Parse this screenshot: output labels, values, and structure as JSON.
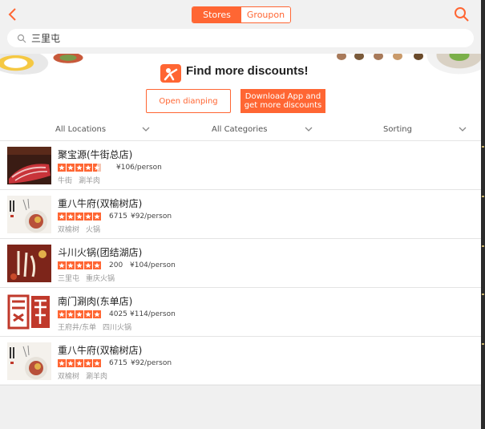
{
  "header": {
    "tabs": [
      {
        "label": "Stores",
        "active": true
      },
      {
        "label": "Groupon",
        "active": false
      }
    ],
    "search_value": "三里屯",
    "back_icon": "back-chevron-icon",
    "search_icon": "search-icon"
  },
  "banner": {
    "title": "Find more discounts!",
    "open_button": "Open dianping",
    "download_button": "Download App and get more discounts"
  },
  "filters": [
    {
      "label": "All Locations"
    },
    {
      "label": "All Categories"
    },
    {
      "label": "Sorting"
    }
  ],
  "stores": [
    {
      "name": "聚宝源(牛街总店)",
      "rating": 4.5,
      "reviews": "",
      "price": "¥106/person",
      "area": "牛街",
      "category": "涮羊肉"
    },
    {
      "name": "重八牛府(双榆树店)",
      "rating": 5,
      "reviews": "6715",
      "price": "¥92/person",
      "area": "双榆树",
      "category": "火锅"
    },
    {
      "name": "斗川火锅(团结湖店)",
      "rating": 5,
      "reviews": "200",
      "price": "¥104/person",
      "area": "三里屯",
      "category": "重庆火锅"
    },
    {
      "name": "南门涮肉(东单店)",
      "rating": 5,
      "reviews": "4025",
      "price": "¥114/person",
      "area": "王府井/东单",
      "category": "四川火锅"
    },
    {
      "name": "重八牛府(双榆树店)",
      "rating": 5,
      "reviews": "6715",
      "price": "¥92/person",
      "area": "双榆树",
      "category": "涮羊肉"
    }
  ],
  "colors": {
    "accent": "#ff6633",
    "star": "#ff6633"
  }
}
